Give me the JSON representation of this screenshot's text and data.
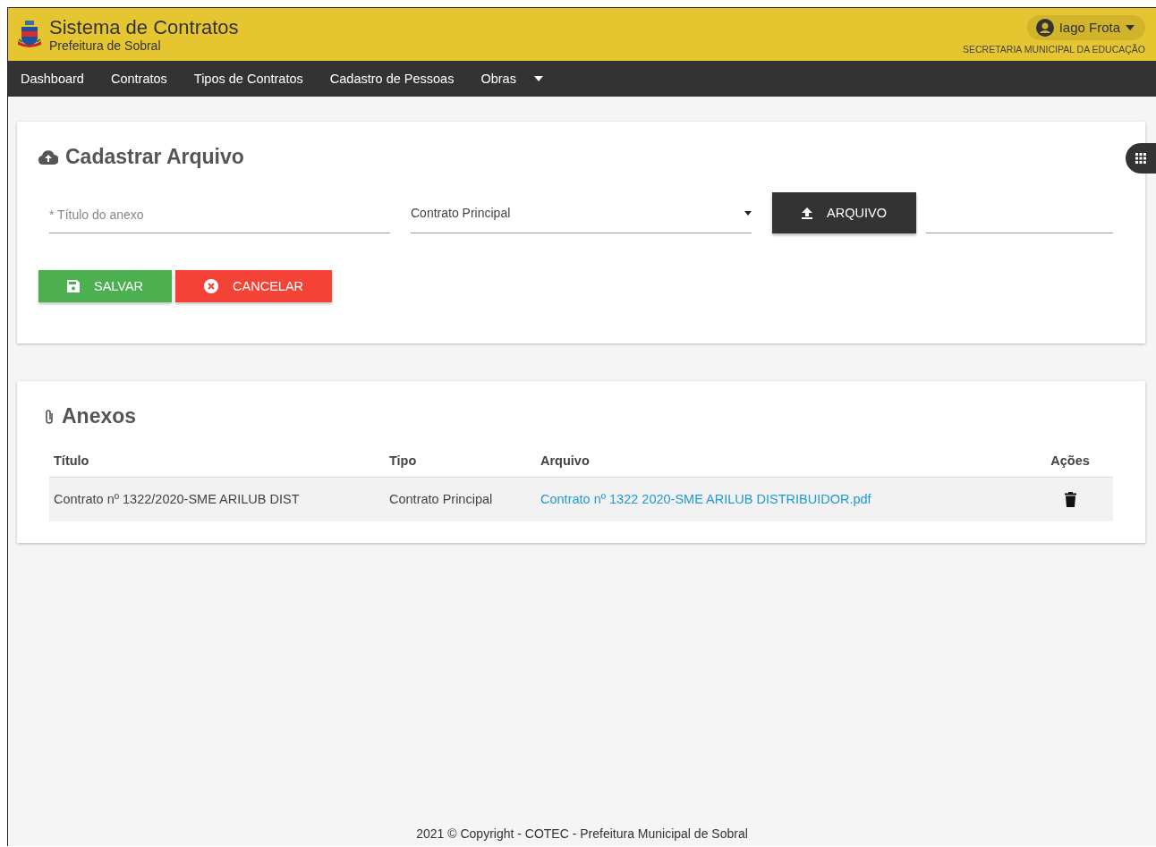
{
  "header": {
    "title": "Sistema de Contratos",
    "subtitle": "Prefeitura de Sobral",
    "user": "Iago Frota",
    "department": "SECRETARIA MUNICIPAL DA EDUCAÇÃO"
  },
  "nav": [
    {
      "label": "Dashboard",
      "dropdown": false
    },
    {
      "label": "Contratos",
      "dropdown": false
    },
    {
      "label": "Tipos de Contratos",
      "dropdown": false
    },
    {
      "label": "Cadastro de Pessoas",
      "dropdown": false
    },
    {
      "label": "Obras",
      "dropdown": true
    }
  ],
  "upload_form": {
    "title": "Cadastrar Arquivo",
    "title_field": {
      "placeholder": "* Título do anexo"
    },
    "type_select": {
      "value": "Contrato Principal"
    },
    "file_button": "ARQUIVO",
    "buttons": [
      {
        "label": "SALVAR",
        "kind": "save"
      },
      {
        "label": "CANCELAR",
        "kind": "cancel"
      }
    ]
  },
  "attachments": {
    "title": "Anexos",
    "columns": [
      "Título",
      "Tipo",
      "Arquivo",
      "Ações"
    ],
    "rows": [
      {
        "title": "Contrato nº 1322/2020-SME ARILUB DIST",
        "type": "Contrato Principal",
        "file": "Contrato nº 1322 2020-SME ARILUB DISTRIBUIDOR.pdf"
      }
    ]
  },
  "footer": "2021 © Copyright - COTEC - Prefeitura Municipal de Sobral"
}
